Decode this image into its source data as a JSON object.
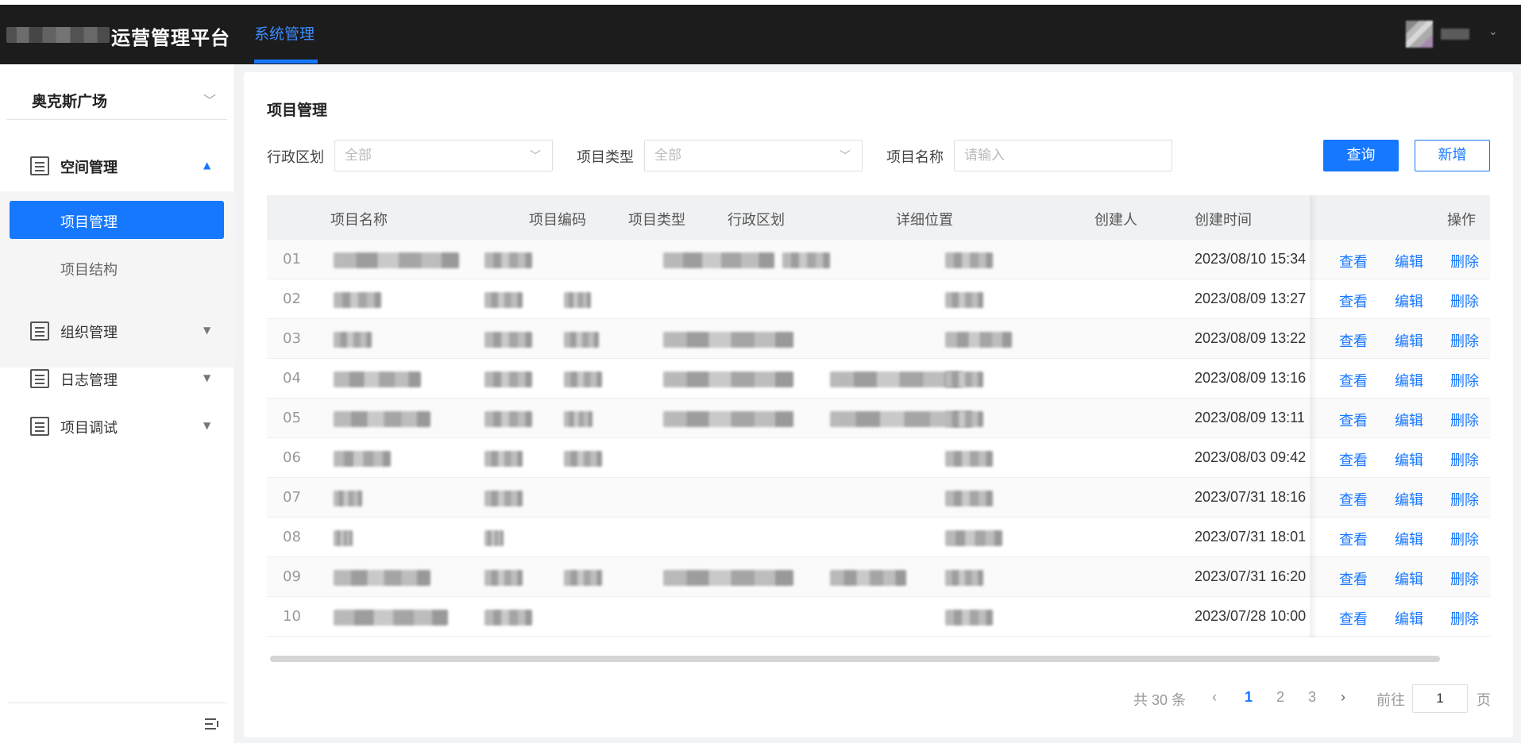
{
  "header": {
    "app_title": "运营管理平台",
    "nav_active": "系统管理"
  },
  "sidebar": {
    "site": "奥克斯广场",
    "groups": [
      {
        "label": "空间管理",
        "open": true,
        "icon": "building-icon",
        "items": [
          {
            "label": "项目管理",
            "active": true
          },
          {
            "label": "项目结构",
            "active": false
          }
        ]
      },
      {
        "label": "组织管理",
        "open": false,
        "icon": "org-tree-icon"
      },
      {
        "label": "日志管理",
        "open": false,
        "icon": "log-settings-icon"
      },
      {
        "label": "项目调试",
        "open": false,
        "icon": "debug-list-icon"
      }
    ]
  },
  "main": {
    "title": "项目管理",
    "filters": {
      "region_label": "行政区划",
      "region_value": "全部",
      "type_label": "项目类型",
      "type_value": "全部",
      "name_label": "项目名称",
      "name_placeholder": "请输入"
    },
    "buttons": {
      "query": "查询",
      "add": "新增"
    }
  },
  "table": {
    "columns": [
      "项目名称",
      "项目编码",
      "项目类型",
      "行政区划",
      "详细位置",
      "创建人",
      "创建时间",
      "操作"
    ],
    "actions": [
      "查看",
      "编辑",
      "删除"
    ],
    "rows": [
      {
        "index": "01",
        "created_at": "2023/08/10 15:34"
      },
      {
        "index": "02",
        "created_at": "2023/08/09 13:27"
      },
      {
        "index": "03",
        "created_at": "2023/08/09 13:22"
      },
      {
        "index": "04",
        "created_at": "2023/08/09 13:16"
      },
      {
        "index": "05",
        "created_at": "2023/08/09 13:11"
      },
      {
        "index": "06",
        "created_at": "2023/08/03 09:42"
      },
      {
        "index": "07",
        "created_at": "2023/07/31 18:16"
      },
      {
        "index": "08",
        "created_at": "2023/07/31 18:01"
      },
      {
        "index": "09",
        "created_at": "2023/07/31 16:20"
      },
      {
        "index": "10",
        "created_at": "2023/07/28 10:00"
      }
    ]
  },
  "pagination": {
    "total": "共 30 条",
    "pages": [
      "1",
      "2",
      "3"
    ],
    "current": "1",
    "goto_label": "前往",
    "goto_value": "1",
    "page_suffix": "页"
  },
  "colors": {
    "accent": "#1677ff",
    "header_bg": "#1c1c1c",
    "nav_active": "#3d8bff"
  }
}
